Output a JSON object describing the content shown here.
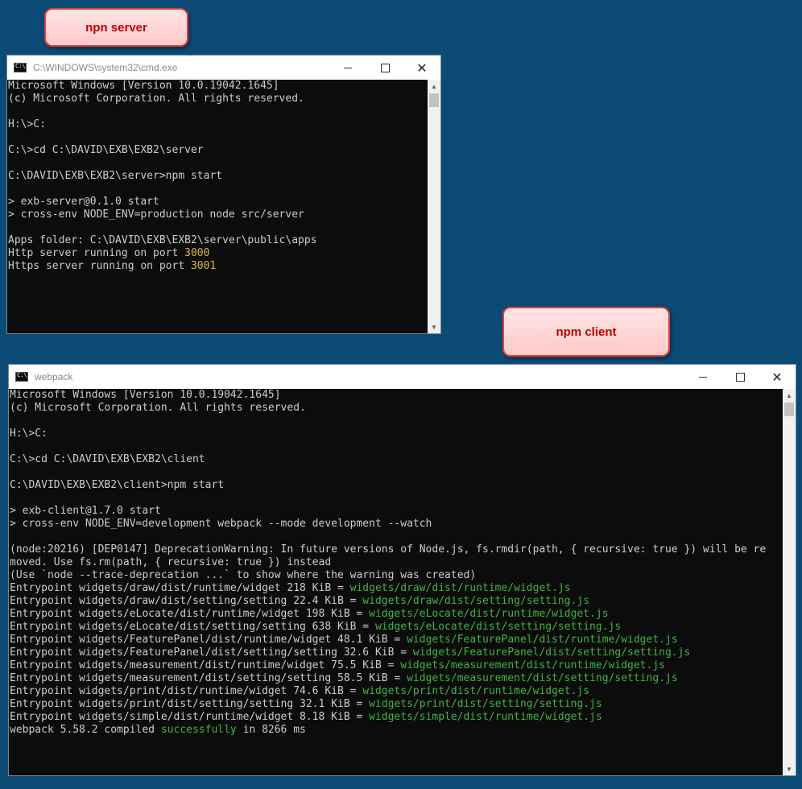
{
  "callouts": {
    "server": "npn server",
    "client": "npm client"
  },
  "server_window": {
    "title": "C:\\WINDOWS\\system32\\cmd.exe",
    "lines": [
      {
        "text": "Microsoft Windows [Version 10.0.19042.1645]"
      },
      {
        "text": "(c) Microsoft Corporation. All rights reserved."
      },
      {
        "text": ""
      },
      {
        "text": "H:\\>C:"
      },
      {
        "text": ""
      },
      {
        "text": "C:\\>cd C:\\DAVID\\EXB\\EXB2\\server"
      },
      {
        "text": ""
      },
      {
        "text": "C:\\DAVID\\EXB\\EXB2\\server>npm start"
      },
      {
        "text": ""
      },
      {
        "text": "> exb-server@0.1.0 start"
      },
      {
        "text": "> cross-env NODE_ENV=production node src/server"
      },
      {
        "text": ""
      },
      {
        "text": "Apps folder: C:\\DAVID\\EXB\\EXB2\\server\\public\\apps"
      },
      {
        "text": "Http server running on port ",
        "port": "3000"
      },
      {
        "text": "Https server running on port ",
        "port": "3001"
      }
    ]
  },
  "client_window": {
    "title": "webpack",
    "lines": [
      {
        "text": "Microsoft Windows [Version 10.0.19042.1645]"
      },
      {
        "text": "(c) Microsoft Corporation. All rights reserved."
      },
      {
        "text": ""
      },
      {
        "text": "H:\\>C:"
      },
      {
        "text": ""
      },
      {
        "text": "C:\\>cd C:\\DAVID\\EXB\\EXB2\\client"
      },
      {
        "text": ""
      },
      {
        "text": "C:\\DAVID\\EXB\\EXB2\\client>npm start"
      },
      {
        "text": ""
      },
      {
        "text": "> exb-client@1.7.0 start"
      },
      {
        "text": "> cross-env NODE_ENV=development webpack --mode development --watch"
      },
      {
        "text": ""
      },
      {
        "text": "(node:20216) [DEP0147] DeprecationWarning: In future versions of Node.js, fs.rmdir(path, { recursive: true }) will be re"
      },
      {
        "text": "moved. Use fs.rm(path, { recursive: true }) instead"
      },
      {
        "text": "(Use `node --trace-deprecation ...` to show where the warning was created)"
      },
      {
        "text": "Entrypoint widgets/draw/dist/runtime/widget 218 KiB = ",
        "green": "widgets/draw/dist/runtime/widget.js"
      },
      {
        "text": "Entrypoint widgets/draw/dist/setting/setting 22.4 KiB = ",
        "green": "widgets/draw/dist/setting/setting.js"
      },
      {
        "text": "Entrypoint widgets/eLocate/dist/runtime/widget 198 KiB = ",
        "green": "widgets/eLocate/dist/runtime/widget.js"
      },
      {
        "text": "Entrypoint widgets/eLocate/dist/setting/setting 638 KiB = ",
        "green": "widgets/eLocate/dist/setting/setting.js"
      },
      {
        "text": "Entrypoint widgets/FeaturePanel/dist/runtime/widget 48.1 KiB = ",
        "green": "widgets/FeaturePanel/dist/runtime/widget.js"
      },
      {
        "text": "Entrypoint widgets/FeaturePanel/dist/setting/setting 32.6 KiB = ",
        "green": "widgets/FeaturePanel/dist/setting/setting.js"
      },
      {
        "text": "Entrypoint widgets/measurement/dist/runtime/widget 75.5 KiB = ",
        "green": "widgets/measurement/dist/runtime/widget.js"
      },
      {
        "text": "Entrypoint widgets/measurement/dist/setting/setting 58.5 KiB = ",
        "green": "widgets/measurement/dist/setting/setting.js"
      },
      {
        "text": "Entrypoint widgets/print/dist/runtime/widget 74.6 KiB = ",
        "green": "widgets/print/dist/runtime/widget.js"
      },
      {
        "text": "Entrypoint widgets/print/dist/setting/setting 32.1 KiB = ",
        "green": "widgets/print/dist/setting/setting.js"
      },
      {
        "text": "Entrypoint widgets/simple/dist/runtime/widget 8.18 KiB = ",
        "green": "widgets/simple/dist/runtime/widget.js"
      },
      {
        "text": "webpack 5.58.2 compiled ",
        "green": "successfully",
        "after": " in 8266 ms"
      }
    ]
  },
  "controls": {
    "minimize_label": "",
    "maximize_label": "",
    "close_label": "✕",
    "scroll_up": "▲",
    "scroll_down": "▼"
  }
}
